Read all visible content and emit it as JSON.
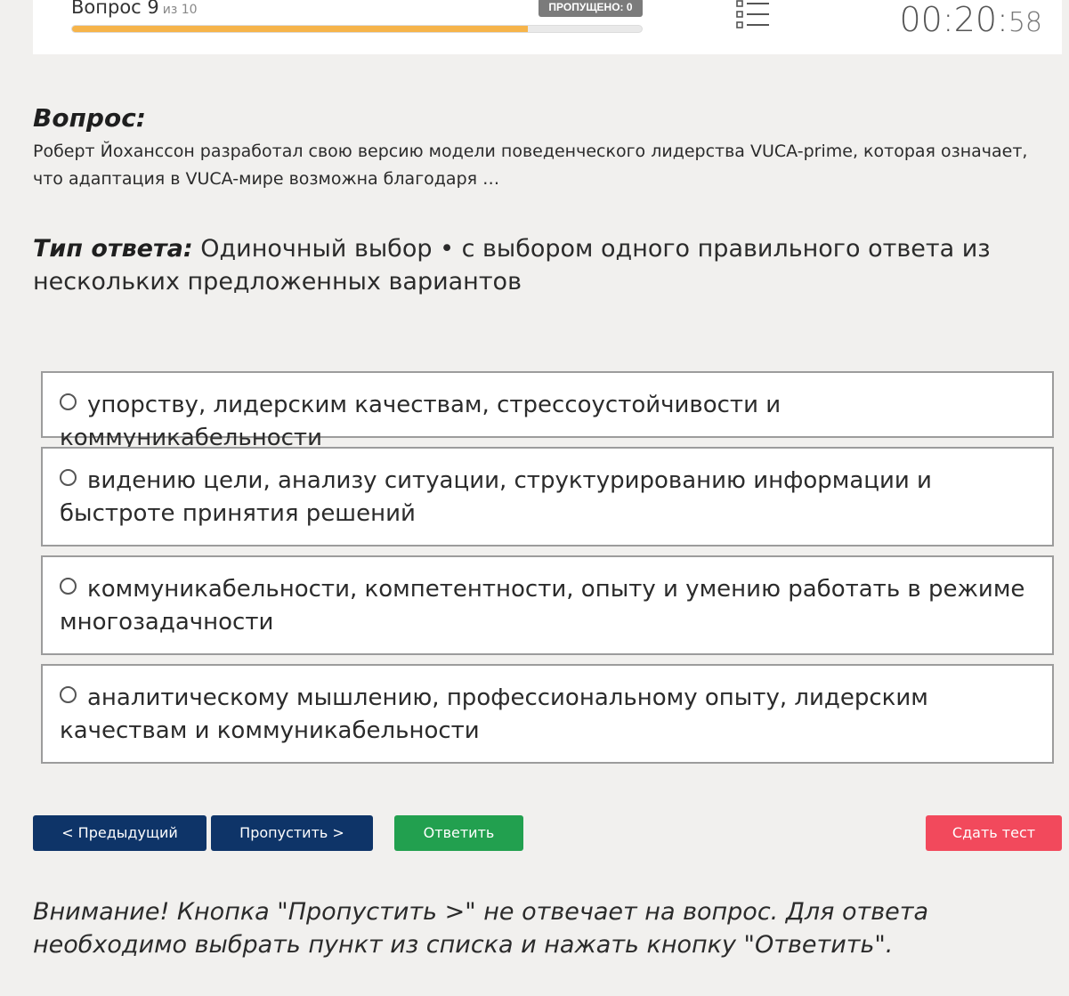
{
  "header": {
    "question_label": "Вопрос 9",
    "question_of": "из 10",
    "skipped_badge": "ПРОПУЩЕНО: 0",
    "progress_fraction": 0.8,
    "timer_main": "00:20:",
    "timer_seconds": "58",
    "list_icon": "list-icon"
  },
  "question": {
    "heading": "Вопрос:",
    "text": "Роберт Йохансcон разработал свою версию модели поведенческого лидерства VUCA-prime, которая означает, что адаптация в VUCA-мире возможна благодаря …"
  },
  "answer_type": {
    "label": "Тип ответа:",
    "value": "Одиночный выбор • с выбором одного правильного ответа из нескольких предложенных вариантов"
  },
  "options": [
    {
      "text": "упорству, лидерским качествам, стрессоустойчивости и коммуникабельности"
    },
    {
      "text": "видению цели, анализу ситуации, структурированию информации и быстроте принятия решений"
    },
    {
      "text": "коммуникабельности, компетентности, опыту и умению работать в режиме многозадачности"
    },
    {
      "text": "аналитическому мышлению, профессиональному опыту, лидерским качествам и коммуникабельности"
    }
  ],
  "buttons": {
    "prev": "< Предыдущий",
    "skip": "Пропустить >",
    "answer": "Ответить",
    "submit": "Сдать тест"
  },
  "warning": "Внимание! Кнопка \"Пропустить >\" не отвечает на вопрос. Для ответа необходимо выбрать пункт из списка и нажать кнопку \"Ответить\".",
  "colors": {
    "progress": "#f6b44a",
    "nav_button": "#0e3468",
    "answer_button": "#22a04f",
    "submit_button": "#f2495c"
  }
}
